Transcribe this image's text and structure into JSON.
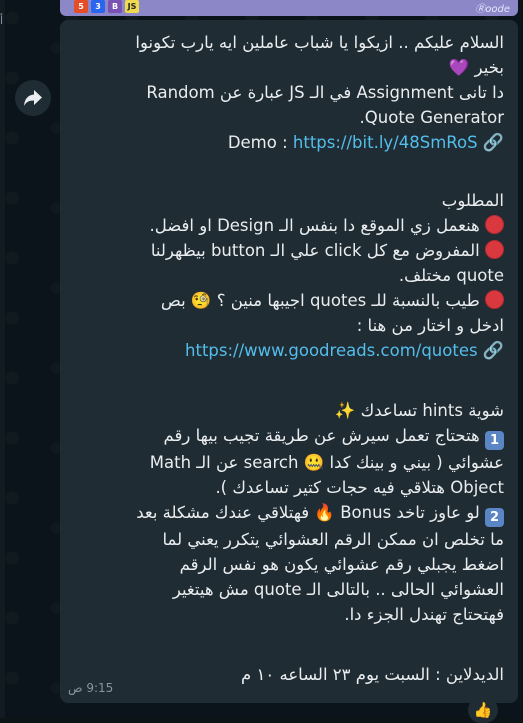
{
  "preview": {
    "brand": "Ⓡoode",
    "badges": [
      "5",
      "3",
      "B",
      "JS"
    ]
  },
  "message": {
    "l1": "السلام عليكم .. ازيكوا يا شباب عاملين ايه يارب تكونوا",
    "l2": "بخير 💜",
    "l3": "دا تانى Assignment في الـ JS عبارة عن Random",
    "l4": "Quote Generator.",
    "demo_label": "Demo :",
    "demo_link": "https://bit.ly/48SmRoS",
    "required": "المطلوب",
    "req1": "هنعمل زي الموقع دا بنفس الـ Design او افضل.",
    "req2": "المفروض مع كل click علي الـ button بيظهرلنا",
    "req2b": "quote مختلف.",
    "req3": "طيب بالنسبة للـ quotes اجيبها منين ؟ 🧐 بص",
    "req3b": "ادخل و اختار من هنا :",
    "quotes_link": "https://www.goodreads.com/quotes",
    "hints_title": "شوية hints تساعدك ✨",
    "h1a": "هتحتاج تعمل سيرش عن طريقة تجيب بيها رقم",
    "h1b": "عشوائي ( بيني و بينك كدا 🤐 search عن الـ Math",
    "h1c": "Object هتلاقي فيه حجات كتير تساعدك ).",
    "h2a": "لو عاوز تاخد Bonus 🔥 فهتلاقي عندك مشكلة بعد",
    "h2b": "ما تخلص ان ممكن الرقم العشوائي يتكرر يعني لما",
    "h2c": "اضغط يجبلي رقم عشوائي يكون هو نفس الرقم",
    "h2d": "العشوائي الحالى .. بالتالى الـ quote مش هيتغير",
    "h2e": "فهتحتاج تهندل الجزء دا.",
    "deadline": "الديدلاين : السبت يوم ٢٣ الساعه ١٠ م",
    "time": "9:15 ص",
    "badge1": "1",
    "badge2": "2"
  },
  "reaction": "👍"
}
